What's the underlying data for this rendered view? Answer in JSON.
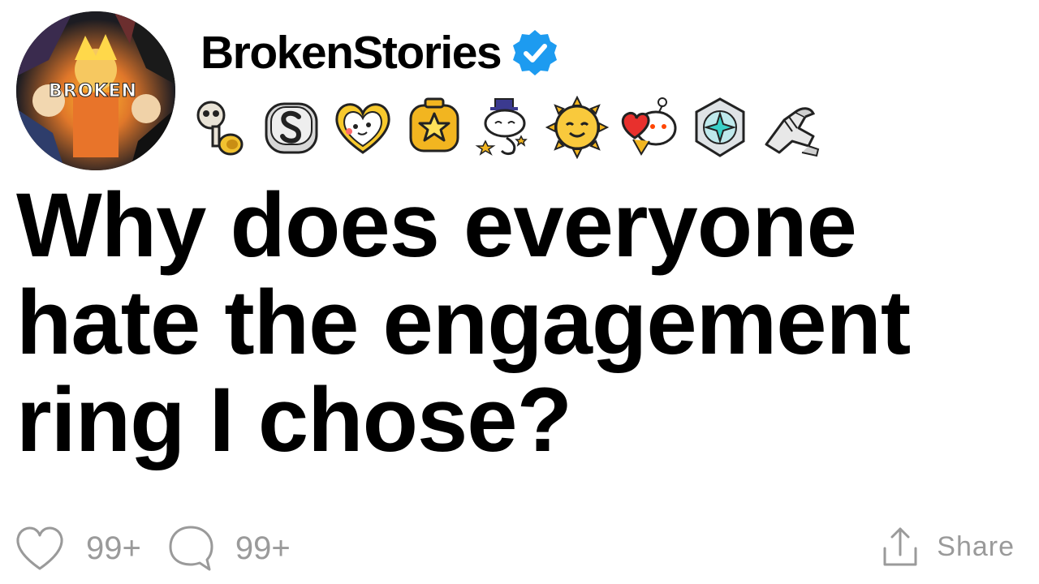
{
  "author": {
    "avatar_text": "BROKEN",
    "username": "BrokenStories",
    "verified_color": "#1d9bf0"
  },
  "awards": [
    {
      "icon": "wearing-is-caring-award-icon"
    },
    {
      "icon": "silver-award-icon"
    },
    {
      "icon": "wholesome-award-icon"
    },
    {
      "icon": "gold-award-icon"
    },
    {
      "icon": "helpful-award-icon"
    },
    {
      "icon": "hugz-award-icon"
    },
    {
      "icon": "heartwarming-award-icon"
    },
    {
      "icon": "platinum-award-icon"
    },
    {
      "icon": "rocket-like-handshake-award-icon"
    }
  ],
  "post": {
    "title": "Why does everyone hate the engagement ring I chose?"
  },
  "actions": {
    "likes": "99+",
    "comments": "99+",
    "share_label": "Share"
  },
  "colors": {
    "muted": "#9a9a9a",
    "text": "#000000"
  }
}
